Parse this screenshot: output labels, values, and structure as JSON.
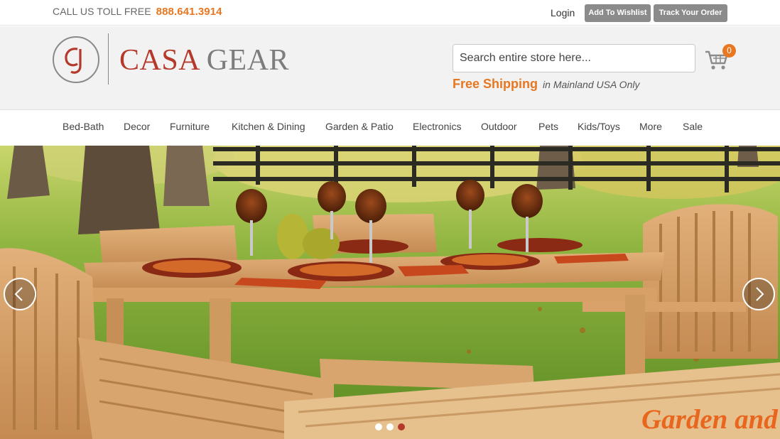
{
  "topbar": {
    "call_label": "CALL US TOLL FREE",
    "phone": "888.641.3914",
    "login_label": "Login",
    "wishlist_label": "Add To Wishlist",
    "track_label": "Track Your Order"
  },
  "header": {
    "logo_casa": "CASA",
    "logo_gear": "GEAR",
    "search_placeholder": "Search entire store here...",
    "cart_count": "0",
    "shipping_highlight": "Free Shipping",
    "shipping_note": "in Mainland USA Only"
  },
  "nav": {
    "items": [
      "Bed-Bath",
      "Decor",
      "Furniture",
      "Kitchen & Dining",
      "Garden & Patio",
      "Electronics",
      "Outdoor",
      "Pets",
      "Kids/Toys",
      "More",
      "Sale"
    ]
  },
  "hero": {
    "caption": "Garden and",
    "slide_count": 3,
    "active_slide": 3
  },
  "colors": {
    "accent_orange": "#e87722",
    "brand_red": "#b5392b",
    "button_gray": "#8b8b8b"
  }
}
